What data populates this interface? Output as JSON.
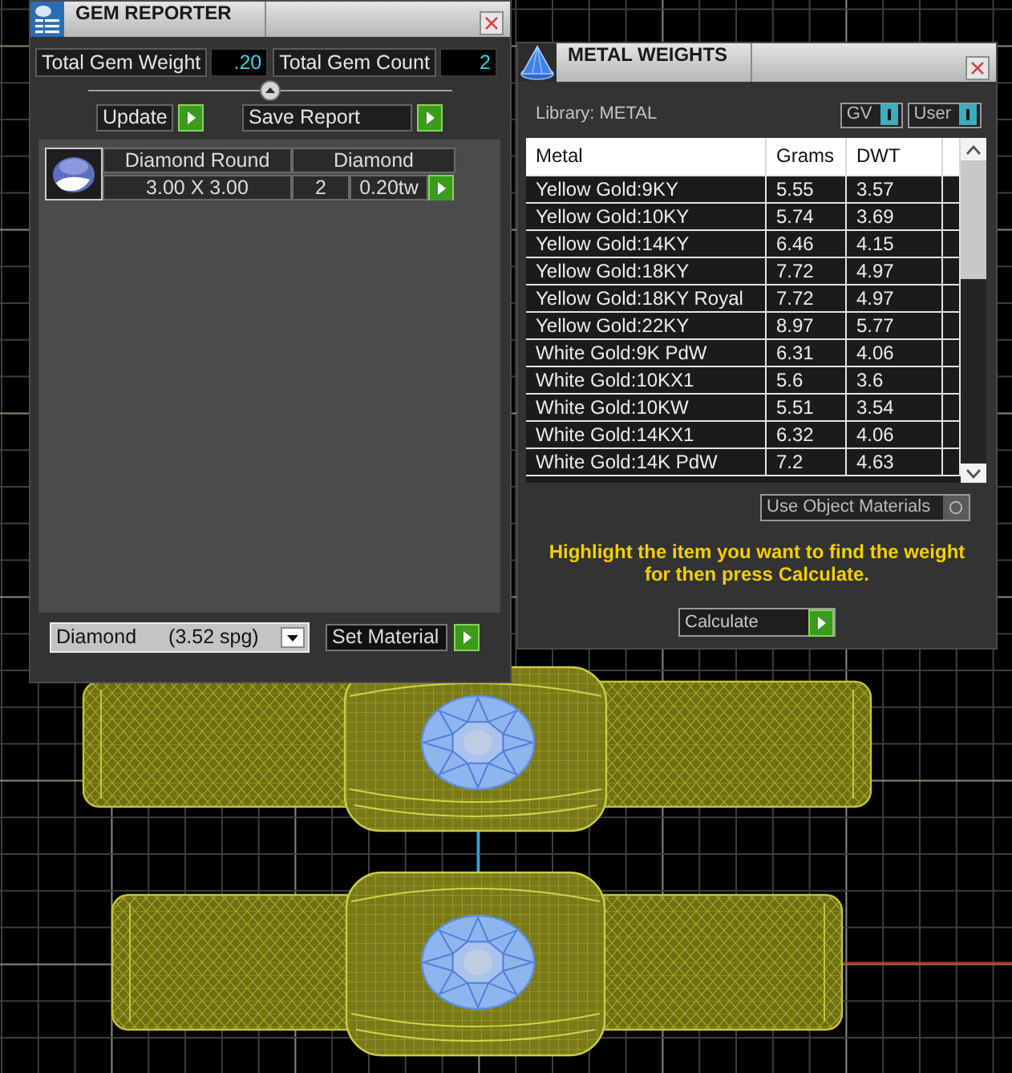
{
  "gem_reporter": {
    "title": "GEM REPORTER",
    "totals": [
      {
        "label": "Total Gem Weight",
        "value": ".20"
      },
      {
        "label": "Total Gem Count",
        "value": "2"
      }
    ],
    "buttons": [
      "Update",
      "Save Report"
    ],
    "gems": [
      {
        "shape": "Diamond Round",
        "material": "Diamond",
        "size": "3.00 X 3.00",
        "count": "2",
        "weight": "0.20tw"
      }
    ],
    "material_select": {
      "value": "Diamond",
      "density": "(3.52 spg)"
    },
    "set_button": "Set Material"
  },
  "metal_weights": {
    "title": "METAL WEIGHTS",
    "library": "Library: METAL",
    "toggles": [
      {
        "label": "GV",
        "on": true
      },
      {
        "label": "User",
        "on": true
      }
    ],
    "table": {
      "columns": [
        "Metal",
        "Grams",
        "DWT"
      ],
      "rows": [
        {
          "cells": [
            "Yellow Gold:9KY",
            "5.55",
            "3.57"
          ],
          "selected": false
        },
        {
          "cells": [
            "Yellow Gold:10KY",
            "5.74",
            "3.69"
          ],
          "selected": false
        },
        {
          "cells": [
            "Yellow Gold:14KY",
            "6.46",
            "4.15"
          ],
          "selected": false
        },
        {
          "cells": [
            "Yellow Gold:18KY",
            "7.72",
            "4.97"
          ],
          "selected": false
        },
        {
          "cells": [
            "Yellow Gold:18KY Royal",
            "7.72",
            "4.97"
          ],
          "selected": false
        },
        {
          "cells": [
            "Yellow Gold:22KY",
            "8.97",
            "5.77"
          ],
          "selected": false
        },
        {
          "cells": [
            "White Gold:9K PdW",
            "6.31",
            "4.06"
          ],
          "selected": false
        },
        {
          "cells": [
            "White Gold:10KX1",
            "5.6",
            "3.6"
          ],
          "selected": false
        },
        {
          "cells": [
            "White Gold:10KW",
            "5.51",
            "3.54"
          ],
          "selected": false
        },
        {
          "cells": [
            "White Gold:14KX1",
            "6.32",
            "4.06"
          ],
          "selected": false
        },
        {
          "cells": [
            "White Gold:14K PdW",
            "7.2",
            "4.63"
          ],
          "selected": false
        }
      ]
    },
    "object_materials": {
      "label": "Use Object Materials",
      "on": false
    },
    "hint": "Highlight the item you want to find the weight for then press Calculate.",
    "calculate_button": "Calculate"
  }
}
